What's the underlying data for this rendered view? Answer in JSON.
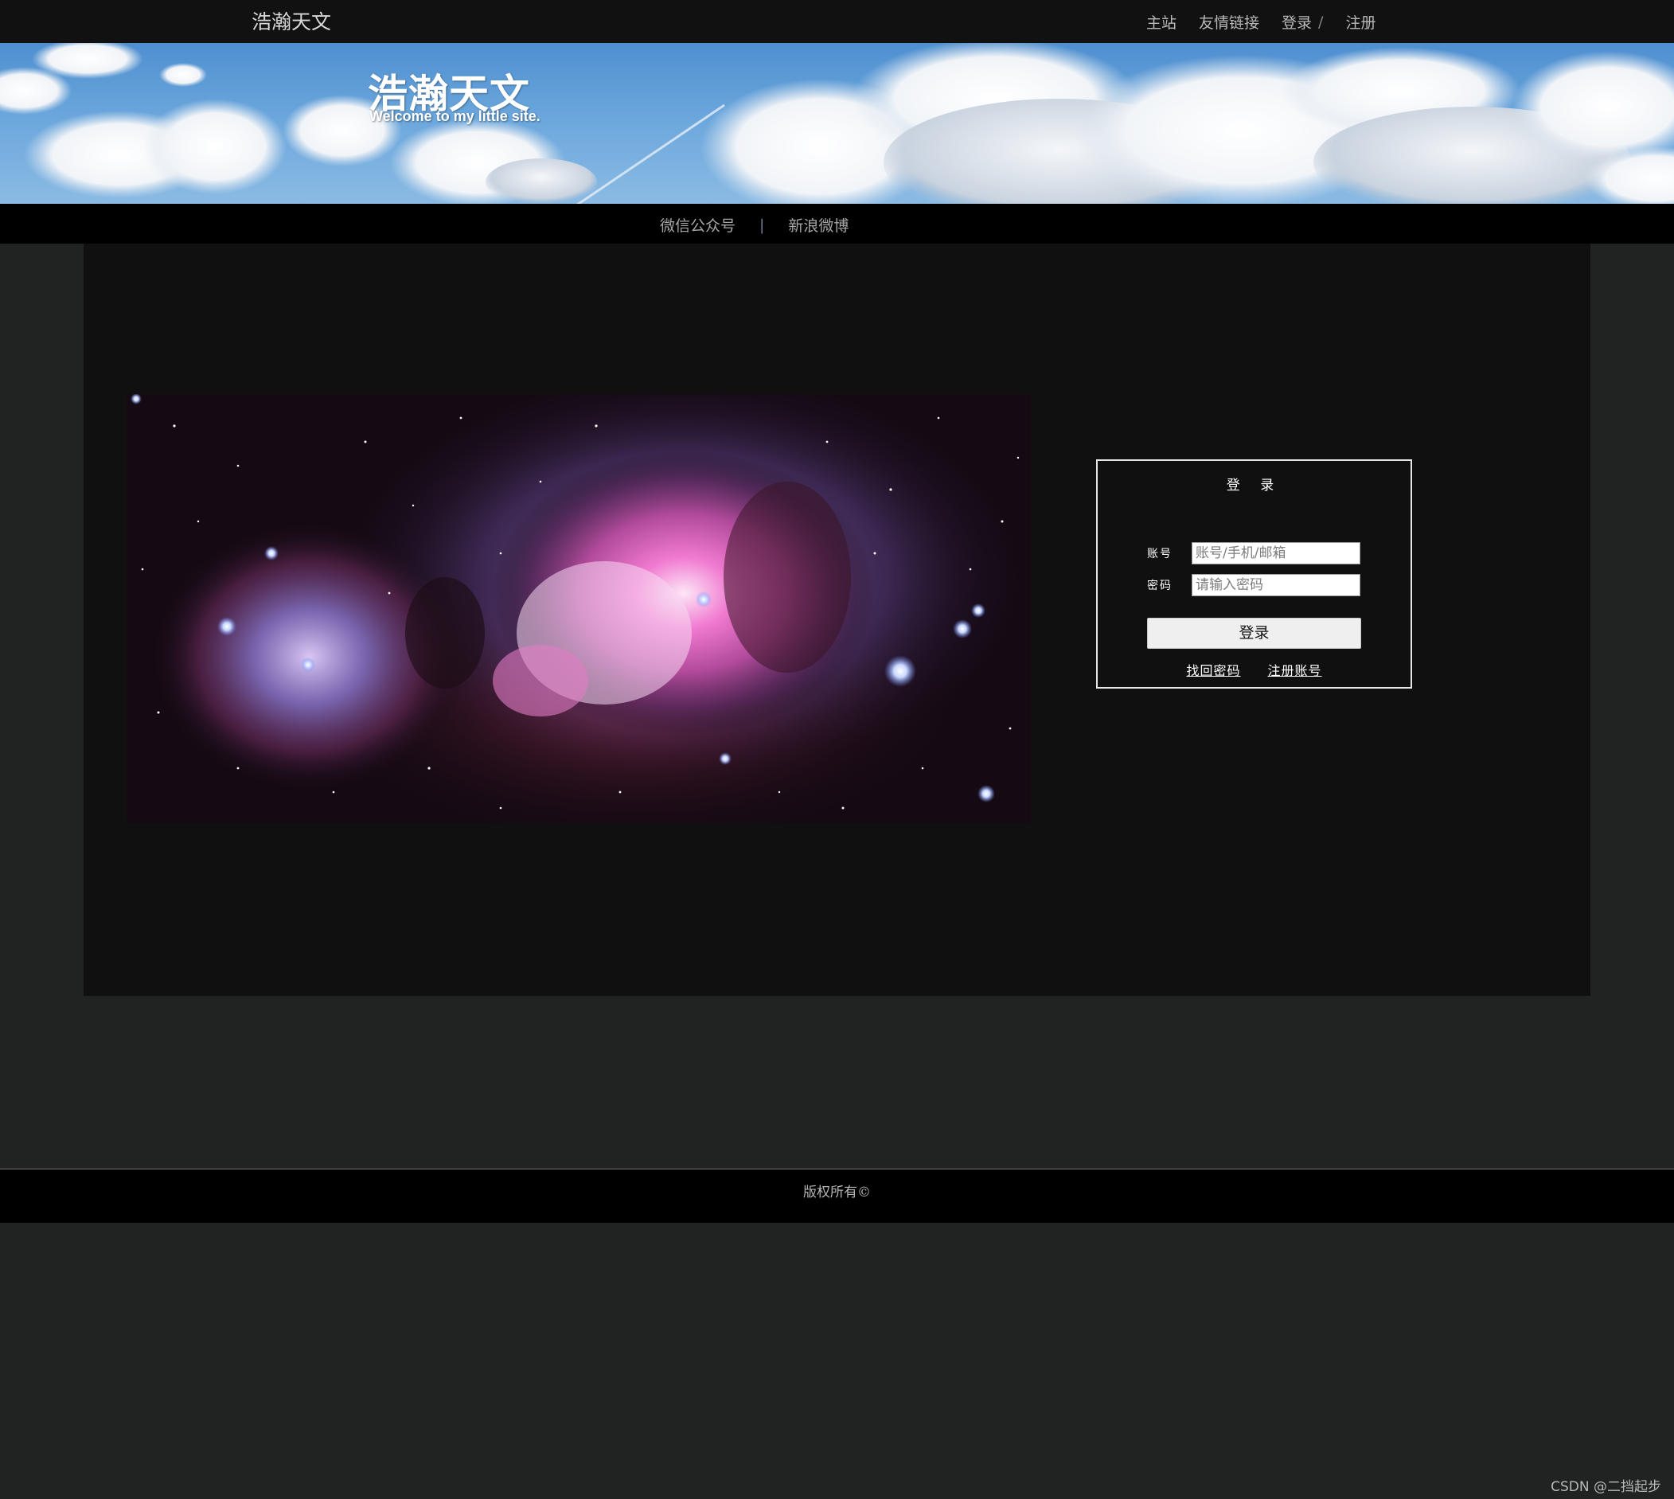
{
  "header": {
    "site_title": "浩瀚天文",
    "nav": {
      "home": "主站",
      "friend_links": "友情链接",
      "login": "登录",
      "login_separator": "/",
      "register": "注册"
    }
  },
  "banner": {
    "title": "浩瀚天文",
    "subtitle": "Welcome to my little site."
  },
  "subnav": {
    "wechat": "微信公众号",
    "divider": "|",
    "weibo": "新浪微博"
  },
  "login_form": {
    "title": "登 录",
    "account_label": "账号",
    "account_placeholder": "账号/手机/邮箱",
    "password_label": "密码",
    "password_placeholder": "请输入密码",
    "submit_label": "登录",
    "forgot_password": "找回密码",
    "register_account": "注册账号"
  },
  "footer": {
    "copyright": "版权所有©"
  },
  "watermark": "CSDN @二挡起步"
}
